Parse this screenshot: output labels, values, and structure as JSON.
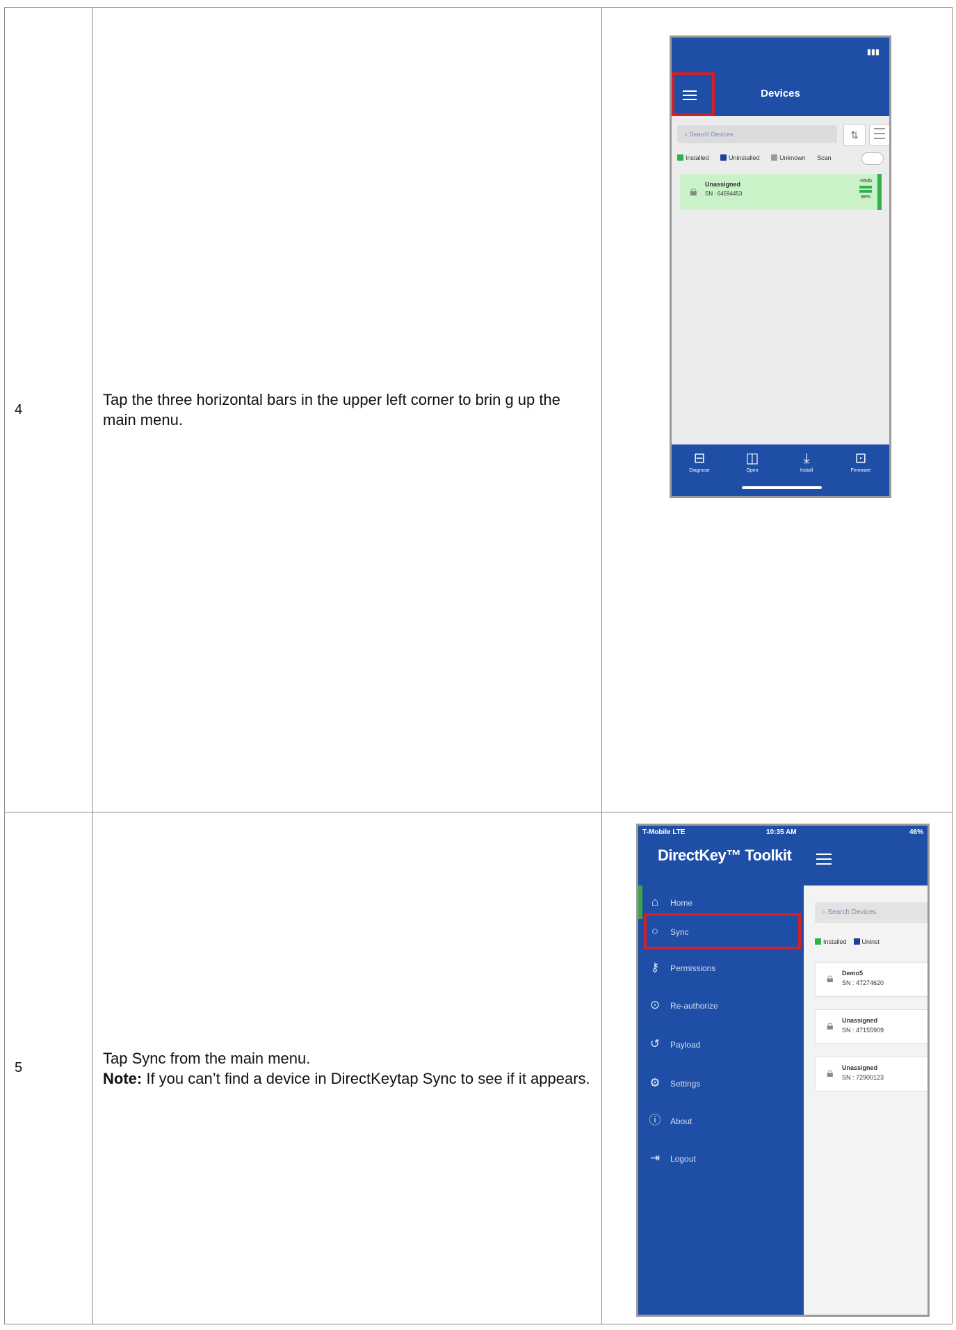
{
  "steps": [
    {
      "number": "4",
      "description": "Tap the three horizontal bars in the upper left corner to brin g up the main menu."
    },
    {
      "number": "5",
      "line1": "Tap Sync from the main menu.",
      "note_label": "Note:",
      "note_text": " If you can’t find a device in DirectKeytap Sync to see if it appears."
    }
  ],
  "screen1": {
    "title": "Devices",
    "search_placeholder": "Search Devices",
    "legend": [
      {
        "label": "Installed",
        "color": "#2fb34a"
      },
      {
        "label": "Uninstalled",
        "color": "#1e3f9c"
      },
      {
        "label": "Unknown",
        "color": "#9a9a9a"
      }
    ],
    "scan_label": "Scan",
    "device": {
      "name": "Unassigned",
      "sn": "SN : 64594453",
      "signal": "-85db",
      "battery": "98%"
    },
    "tabs": [
      "Diagnose",
      "Open",
      "Install",
      "Firmware"
    ]
  },
  "screen2": {
    "carrier": "T-Mobile LTE",
    "time": "10:35 AM",
    "battery": "46%",
    "brand": "DirectKey™ Toolkit",
    "menu": [
      "Home",
      "Sync",
      "Permissions",
      "Re-authorize",
      "Payload",
      "Settings",
      "About",
      "Logout"
    ],
    "search_placeholder": "Search Devices",
    "legend": [
      {
        "label": "Installed",
        "color": "#2fb34a"
      },
      {
        "label": "Uninst",
        "color": "#1e3f9c"
      }
    ],
    "devices": [
      {
        "name": "Demo5",
        "sn": "SN : 47274620"
      },
      {
        "name": "Unassigned",
        "sn": "SN : 47155909"
      },
      {
        "name": "Unassigned",
        "sn": "SN : 72900123"
      }
    ]
  }
}
